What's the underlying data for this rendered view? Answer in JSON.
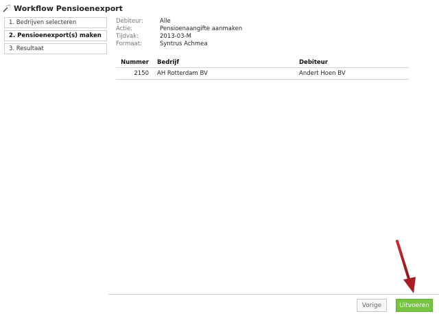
{
  "title": "Workflow Pensioenexport",
  "steps": [
    {
      "label": "1. Bedrijven selecteren",
      "active": false
    },
    {
      "label": "2. Pensioenexport(s) maken",
      "active": true
    },
    {
      "label": "3. Resultaat",
      "active": false
    }
  ],
  "info": [
    {
      "label": "Debiteur:",
      "value": "Alle"
    },
    {
      "label": "Actie:",
      "value": "Pensioenaangifte aanmaken"
    },
    {
      "label": "Tijdvak:",
      "value": "2013-03-M"
    },
    {
      "label": "Formaat:",
      "value": "Syntrus Achmea"
    }
  ],
  "table": {
    "headers": [
      "Nummer",
      "Bedrijf",
      "Debiteur"
    ],
    "rows": [
      {
        "nummer": "2150",
        "bedrijf": "AH Rotterdam BV",
        "debiteur": "Andert Hoen BV"
      }
    ]
  },
  "buttons": {
    "prev_label": "Vorige",
    "run_label": "Uitvoeren"
  },
  "colors": {
    "run_button": "#76c442",
    "annotation_arrow": "#b3262a"
  },
  "icons": {
    "title_icon": "magic-wand-icon"
  }
}
